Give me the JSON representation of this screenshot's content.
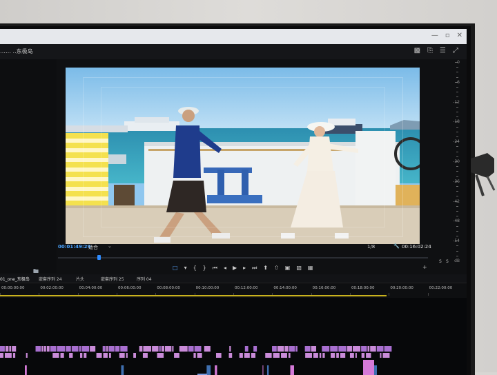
{
  "monitor": {
    "panel_title": "…… ..东极岛",
    "header_icons": [
      "export-frame-icon",
      "export-icon",
      "settings-icon",
      "expand-icon"
    ],
    "window_buttons": [
      "minimize-icon",
      "maximize-icon",
      "close-icon"
    ]
  },
  "program": {
    "timecode_current": "00:01:49:29",
    "fit_label": "适合",
    "resolution": "1/8",
    "timecode_duration": "00:16:02:24",
    "playhead_fraction": 0.11,
    "ruler_numbers": [
      "0",
      "-6",
      "-12",
      "-18",
      "-24",
      "-30",
      "-36",
      "-42",
      "-48",
      "-54",
      "dB"
    ],
    "bottom_right": [
      "S",
      "S"
    ],
    "controls": [
      {
        "name": "marker-icon",
        "glyph": "□",
        "active": true
      },
      {
        "name": "add-marker-icon",
        "glyph": "▾"
      },
      {
        "name": "mark-in-icon",
        "glyph": "{"
      },
      {
        "name": "mark-out-icon",
        "glyph": "}"
      },
      {
        "name": "go-to-in-icon",
        "glyph": "⏮"
      },
      {
        "name": "step-back-icon",
        "glyph": "◂"
      },
      {
        "name": "play-icon",
        "glyph": "▶"
      },
      {
        "name": "step-forward-icon",
        "glyph": "▸"
      },
      {
        "name": "go-to-out-icon",
        "glyph": "⏭"
      },
      {
        "name": "lift-icon",
        "glyph": "⬆"
      },
      {
        "name": "extract-icon",
        "glyph": "⇧"
      },
      {
        "name": "export-frame-icon",
        "glyph": "▣"
      },
      {
        "name": "comparison-view-icon",
        "glyph": "▧"
      },
      {
        "name": "multicam-icon",
        "glyph": "▦"
      }
    ],
    "plus_glyph": "+"
  },
  "sequence_tabs": [
    {
      "label": "01_one_东极岛",
      "active": true
    },
    {
      "label": "嵌套序列 24"
    },
    {
      "label": "片头"
    },
    {
      "label": "嵌套序列 25"
    },
    {
      "label": "序列 04"
    }
  ],
  "timeline": {
    "timecodes": [
      "00:00:00:00",
      "00:02:00:00",
      "00:04:00:00",
      "00:06:00:00",
      "00:08:00:00",
      "00:10:00:00",
      "00:12:00:00",
      "00:14:00:00",
      "00:16:00:00",
      "00:18:00:00",
      "00:20:00:00",
      "00:22:00:00"
    ],
    "clip_color": "#c98bd9",
    "clip_color_alt": "#a86fd0"
  }
}
